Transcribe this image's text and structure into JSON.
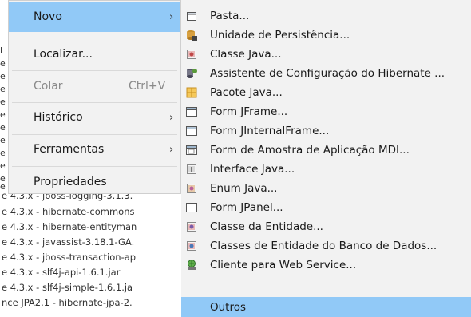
{
  "context_menu": {
    "items": [
      {
        "label": "Novo",
        "shortcut": "",
        "submenu": true,
        "highlighted": true,
        "enabled": true
      },
      {
        "label": "Localizar...",
        "shortcut": "",
        "submenu": false,
        "highlighted": false,
        "enabled": true
      },
      {
        "label": "Colar",
        "shortcut": "Ctrl+V",
        "submenu": false,
        "highlighted": false,
        "enabled": false
      },
      {
        "label": "Histórico",
        "shortcut": "",
        "submenu": true,
        "highlighted": false,
        "enabled": true
      },
      {
        "label": "Ferramentas",
        "shortcut": "",
        "submenu": true,
        "highlighted": false,
        "enabled": true
      },
      {
        "label": "Propriedades",
        "shortcut": "",
        "submenu": false,
        "highlighted": false,
        "enabled": true
      }
    ],
    "arrow_glyph": "›",
    "highlight_color": "#91c9f7"
  },
  "submenu": {
    "items": [
      {
        "label": "Pasta...",
        "icon": "folder-icon"
      },
      {
        "label": "Unidade de Persistência...",
        "icon": "persistence-unit-icon"
      },
      {
        "label": "Classe Java...",
        "icon": "java-class-icon"
      },
      {
        "label": "Assistente de Configuração do Hibernate ...",
        "icon": "hibernate-icon"
      },
      {
        "label": "Pacote Java...",
        "icon": "java-package-icon"
      },
      {
        "label": "Form JFrame...",
        "icon": "jframe-form-icon"
      },
      {
        "label": "Form JInternalFrame...",
        "icon": "jinternalframe-form-icon"
      },
      {
        "label": "Form de Amostra de Aplicação MDI...",
        "icon": "mdi-form-icon"
      },
      {
        "label": "Interface Java...",
        "icon": "java-interface-icon"
      },
      {
        "label": "Enum Java...",
        "icon": "java-enum-icon"
      },
      {
        "label": "Form JPanel...",
        "icon": "jpanel-form-icon"
      },
      {
        "label": "Classe da Entidade...",
        "icon": "entity-class-icon"
      },
      {
        "label": "Classes de Entidade do Banco de Dados...",
        "icon": "entity-db-icon"
      },
      {
        "label": "Cliente para Web Service...",
        "icon": "web-service-client-icon"
      },
      {
        "label": "Outros",
        "icon": ""
      }
    ]
  },
  "background_tree": {
    "rows": [
      "e 4.3.x - jboss-logging-3.1.3.",
      "e 4.3.x - hibernate-commons",
      "e 4.3.x - hibernate-entityman",
      "e 4.3.x - javassist-3.18.1-GA.",
      "e 4.3.x - jboss-transaction-ap",
      "e 4.3.x - slf4j-api-1.6.1.jar",
      "e 4.3.x - slf4j-simple-1.6.1.ja",
      "nce JPA2.1 - hibernate-jpa-2."
    ],
    "stubs": [
      "l",
      "e",
      "e",
      "e",
      "e",
      "e",
      "e",
      "e",
      "e",
      "e",
      "e",
      "e"
    ]
  }
}
